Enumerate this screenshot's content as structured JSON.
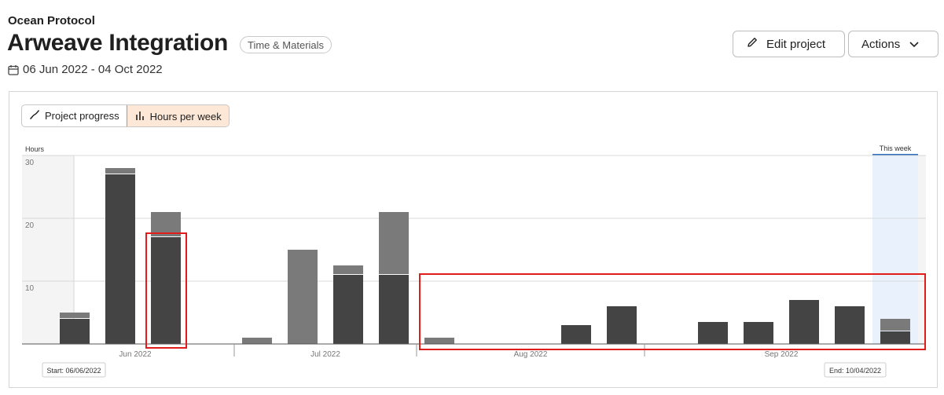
{
  "header": {
    "org": "Ocean Protocol",
    "title": "Arweave Integration",
    "badge": "Time & Materials",
    "date_range": "06 Jun 2022 - 04 Oct 2022",
    "edit_label": "Edit project",
    "actions_label": "Actions"
  },
  "toggle": {
    "progress_label": "Project progress",
    "hours_label": "Hours per week",
    "active": "hours"
  },
  "colors": {
    "bar_dark": "#444444",
    "bar_light": "#7a7a7a",
    "this_week_bg": "#e8f2fd",
    "this_week_line": "#2f6fc0",
    "accent": "#e08a4a",
    "annotation": "#e21b1b"
  },
  "chart_data": {
    "type": "bar",
    "stacked": true,
    "ylabel": "Hours",
    "ylim": [
      0,
      30
    ],
    "yticks": [
      10,
      20,
      30
    ],
    "grid": true,
    "months": [
      "Jun 2022",
      "Jul 2022",
      "Aug 2022",
      "Sep 2022"
    ],
    "weeks": [
      {
        "dark": 4,
        "light": 1
      },
      {
        "dark": 27,
        "light": 1
      },
      {
        "dark": 17,
        "light": 4
      },
      {
        "dark": 0,
        "light": 0
      },
      {
        "dark": 0,
        "light": 1
      },
      {
        "dark": 0,
        "light": 15
      },
      {
        "dark": 11,
        "light": 1.5
      },
      {
        "dark": 11,
        "light": 10
      },
      {
        "dark": 0,
        "light": 1
      },
      {
        "dark": 0,
        "light": 0
      },
      {
        "dark": 0,
        "light": 0
      },
      {
        "dark": 3,
        "light": 0
      },
      {
        "dark": 6,
        "light": 0
      },
      {
        "dark": 0,
        "light": 0
      },
      {
        "dark": 3.5,
        "light": 0
      },
      {
        "dark": 3.5,
        "light": 0
      },
      {
        "dark": 7,
        "light": 0
      },
      {
        "dark": 6,
        "light": 0
      },
      {
        "dark": 2,
        "light": 2
      }
    ],
    "this_week_label": "This week",
    "start_label": "Start: 06/06/2022",
    "end_label": "End: 10/04/2022"
  }
}
